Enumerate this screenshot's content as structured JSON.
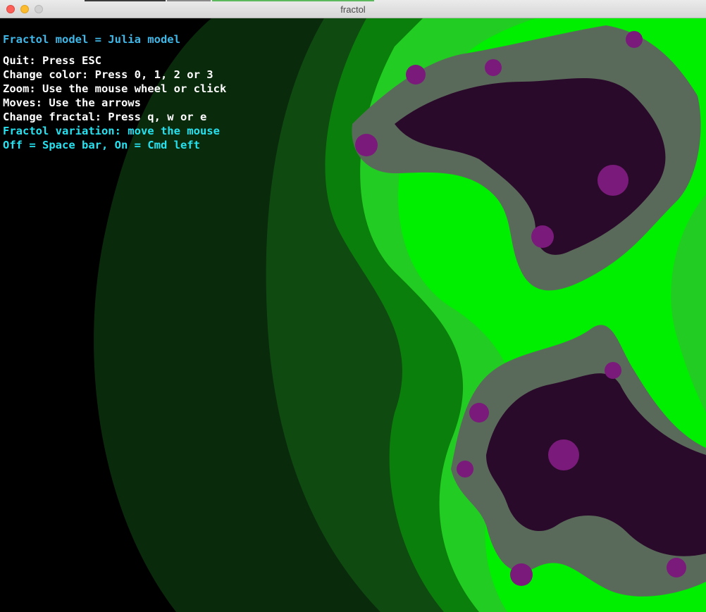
{
  "window": {
    "title": "fractol"
  },
  "hud": {
    "model": "Fractol model = Julia model",
    "quit": "Quit: Press ESC",
    "change_color": "Change color: Press 0, 1, 2 or 3",
    "zoom": "Zoom: Use the mouse wheel or click",
    "moves": "Moves: Use the arrows",
    "change_fractal": "Change fractal: Press q, w or e",
    "variation": "Fractol variation: move the mouse",
    "toggle": "Off = Space bar, On = Cmd left"
  },
  "colors": {
    "background": "#000000",
    "band_dark": "#0a2a0c",
    "band_mid": "#0f4a10",
    "band_green": "#0b7f0b",
    "band_bright": "#22cc22",
    "band_neon": "#00ee00",
    "fractal_core": "#2a0a2a",
    "fractal_purple": "#7a1a7a",
    "fractal_gray": "#5a6a5a",
    "hud_model": "#3fb8e8",
    "hud_text": "#ffffff",
    "hud_accent": "#26e2f0"
  }
}
